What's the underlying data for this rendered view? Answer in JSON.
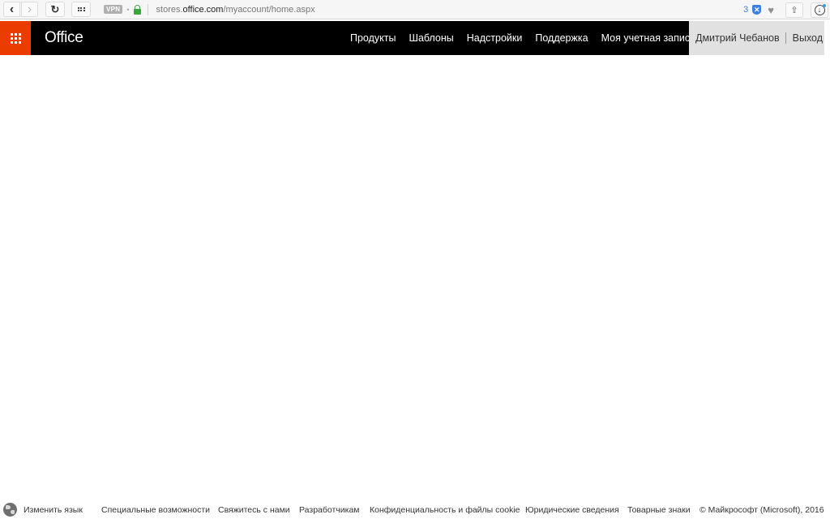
{
  "browser": {
    "url_prefix": "stores.",
    "url_host": "office.com",
    "url_path": "/myaccount/home.aspx",
    "vpn_label": "VPN",
    "tracker_count": "3",
    "back_glyph": "‹",
    "forward_glyph": "›",
    "reload_glyph": "↻",
    "icons": {
      "back": "chevron-left-icon",
      "forward": "chevron-right-icon",
      "reload": "reload-icon",
      "apps": "grid-icon",
      "lock": "lock-icon",
      "shield": "shield-icon",
      "heart": "heart-icon",
      "share": "share-icon",
      "download": "download-icon"
    }
  },
  "header": {
    "brand": "Office",
    "accent_color": "#eb3c00",
    "nav": [
      {
        "label": "Продукты"
      },
      {
        "label": "Шаблоны"
      },
      {
        "label": "Надстройки"
      },
      {
        "label": "Поддержка"
      },
      {
        "label": "Моя учетная запись"
      }
    ],
    "user_name": "Дмитрий Чебанов",
    "sign_out": "Выход"
  },
  "footer": {
    "change_language": "Изменить язык",
    "links": [
      {
        "label": "Специальные возможности"
      },
      {
        "label": "Свяжитесь с нами"
      },
      {
        "label": "Разработчикам"
      },
      {
        "label": "Конфиденциальность и файлы cookie"
      },
      {
        "label": "Юридические сведения"
      },
      {
        "label": "Товарные знаки"
      }
    ],
    "copyright": "© Майкрософт (Microsoft), 2016"
  }
}
